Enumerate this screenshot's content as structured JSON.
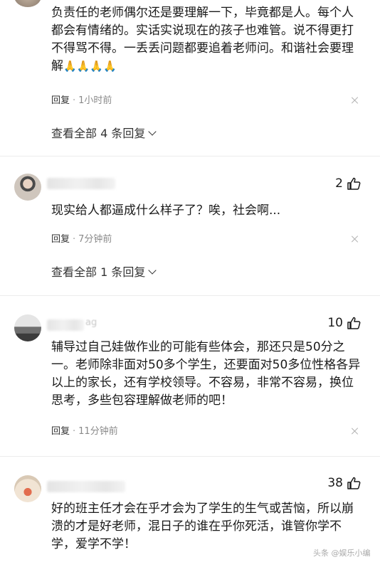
{
  "comments": [
    {
      "text": "负责任的老师偶尔还是要理解一下，毕竟都是人。每个人都会有情绪的。实话实说现在的孩子也难管。说不得更打不得骂不得。一丢丢问题都要追着老师问。和谐社会要理解",
      "emoji": "🙏🙏🙏🙏",
      "reply_label": "回复",
      "time": "1小时前",
      "view_more": "查看全部 4 条回复"
    },
    {
      "likes": "2",
      "text": "现实给人都逼成什么样子了？唉，社会啊...",
      "reply_label": "回复",
      "time": "7分钟前",
      "view_more": "查看全部 1 条回复"
    },
    {
      "likes": "10",
      "name_fragment": "ag",
      "text": "辅导过自己娃做作业的可能有些体会，那还只是50分之一。老师除非面对50多个学生，还要面对50多位性格各异以上的家长，还有学校领导。不容易，非常不容易，换位思考，多些包容理解做老师的吧！",
      "reply_label": "回复",
      "time": "11分钟前"
    },
    {
      "likes": "38",
      "text": "好的班主任才会在乎才会为了学生的生气或苦恼，所以崩溃的才是好老师，混日子的谁在乎你死活，谁管你学不学，爱学不学！"
    }
  ],
  "separator": "·",
  "watermark": "头条 @娱乐小编"
}
